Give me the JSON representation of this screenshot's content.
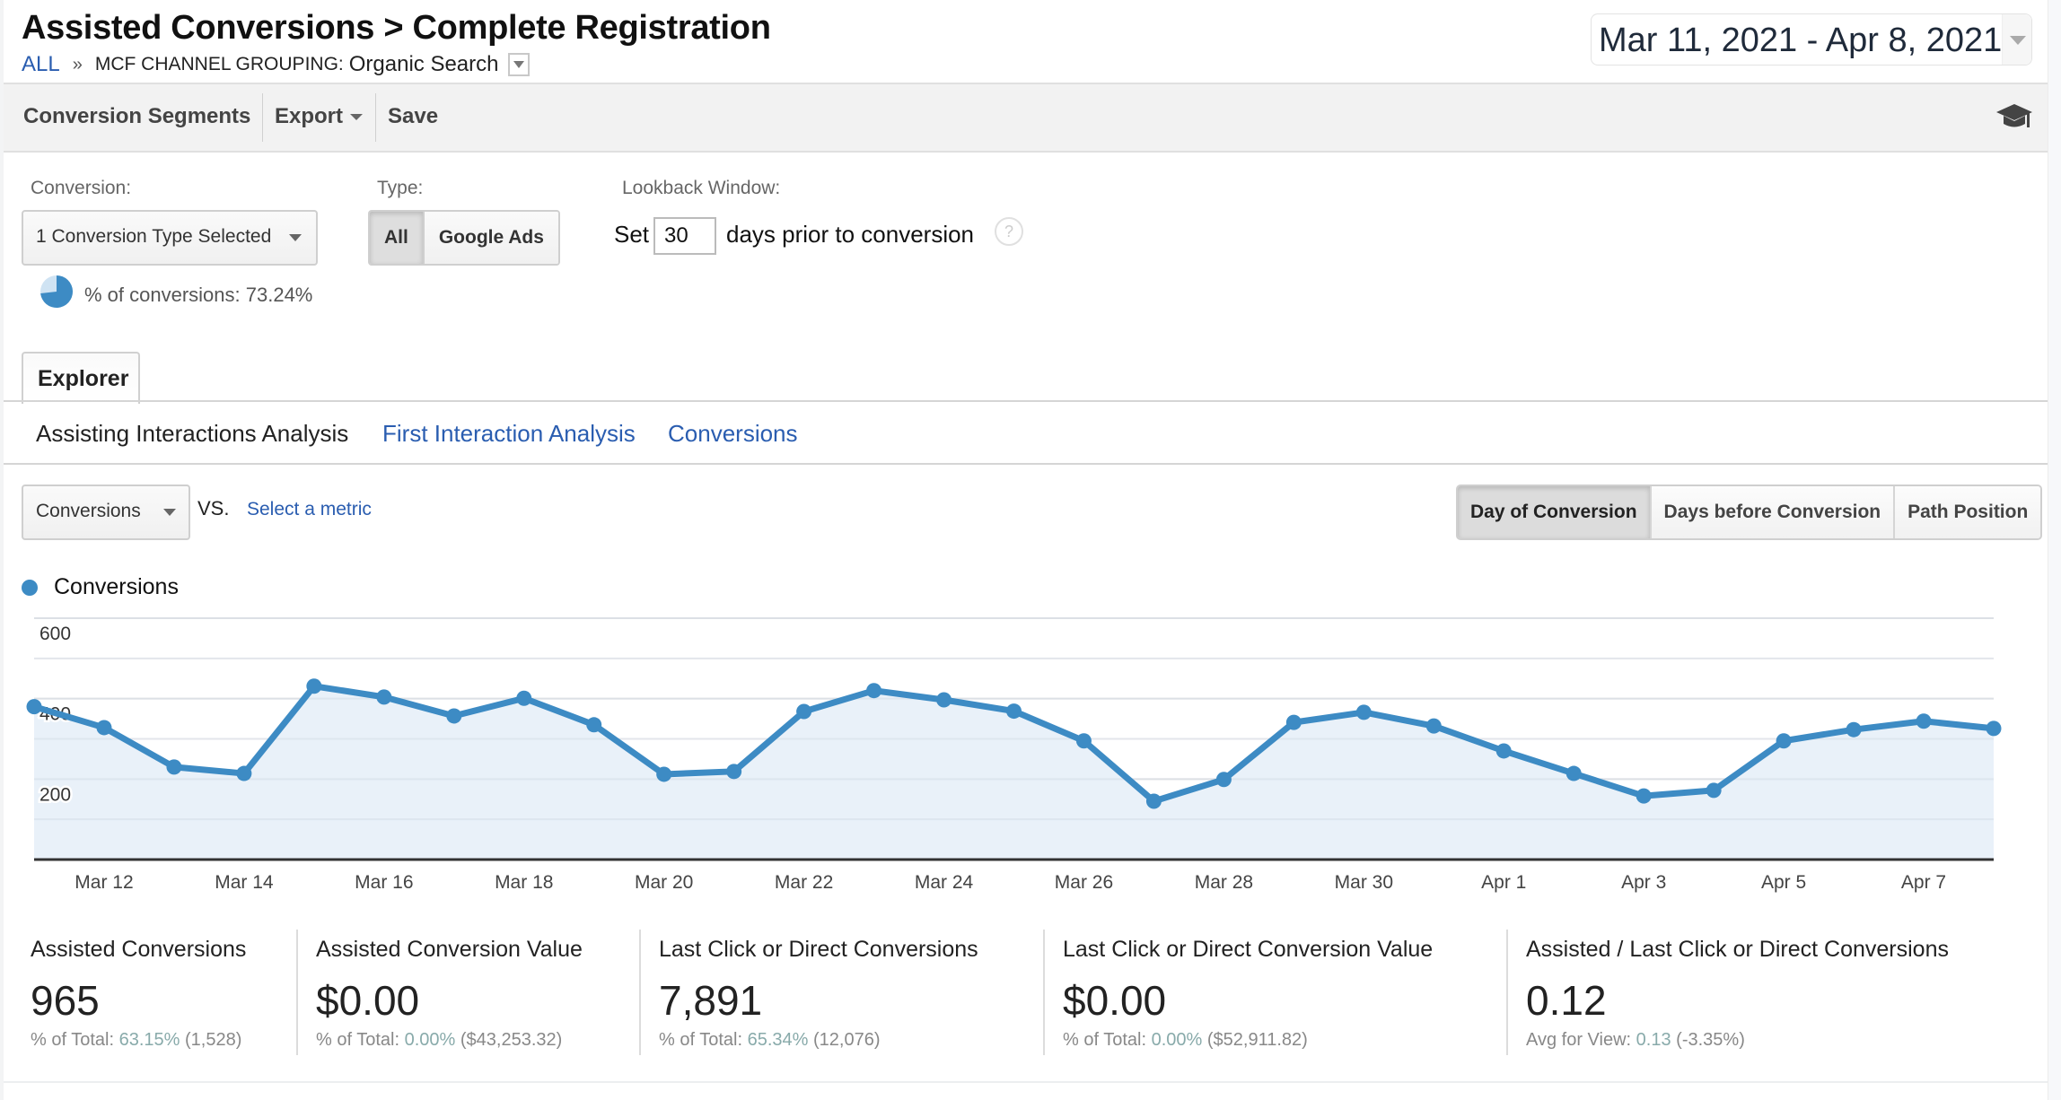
{
  "header": {
    "title": "Assisted Conversions > Complete Registration",
    "breadcrumb": {
      "all": "ALL",
      "separator": "»",
      "group_label": "MCF Channel Grouping:",
      "group_value": "Organic Search"
    },
    "date_range": "Mar 11, 2021 - Apr 8, 2021"
  },
  "toolbar": {
    "conversion_segments": "Conversion Segments",
    "export": "Export",
    "save": "Save",
    "help_icon": "graduation-cap-icon"
  },
  "controls": {
    "conversion_label": "Conversion:",
    "conversion_value": "1 Conversion Type Selected",
    "pct_of_conversions": "% of conversions: 73.24%",
    "pct_of_conversions_value": 73.24,
    "type_label": "Type:",
    "type_options": [
      "All",
      "Google Ads"
    ],
    "type_selected": "All",
    "lookback_label": "Lookback Window:",
    "lookback_prefix": "Set",
    "lookback_days": "30",
    "lookback_suffix": "days prior to conversion",
    "help": "?"
  },
  "tabs": {
    "explorer": "Explorer",
    "subtabs": [
      {
        "label": "Assisting Interactions Analysis",
        "active": true
      },
      {
        "label": "First Interaction Analysis",
        "active": false
      },
      {
        "label": "Conversions",
        "active": false
      }
    ]
  },
  "metric_row": {
    "metric": "Conversions",
    "vs": "VS.",
    "select_metric": "Select a metric",
    "views": [
      {
        "label": "Day of Conversion",
        "active": true
      },
      {
        "label": "Days before Conversion",
        "active": false
      },
      {
        "label": "Path Position",
        "active": false
      }
    ]
  },
  "colors": {
    "series": "#3d8bc4",
    "area": "#e9f1f9",
    "link": "#2a5db0"
  },
  "chart_data": {
    "type": "area",
    "title": "",
    "legend": [
      "Conversions"
    ],
    "legend_position": "top-left",
    "xlabel": "",
    "ylabel": "",
    "ylim": [
      0,
      600
    ],
    "y_ticks": [
      200,
      400,
      600
    ],
    "grid": true,
    "x_tick_labels": [
      "Mar 12",
      "Mar 14",
      "Mar 16",
      "Mar 18",
      "Mar 20",
      "Mar 22",
      "Mar 24",
      "Mar 26",
      "Mar 28",
      "Mar 30",
      "Apr 1",
      "Apr 3",
      "Apr 5",
      "Apr 7"
    ],
    "x": [
      "Mar 11",
      "Mar 12",
      "Mar 13",
      "Mar 14",
      "Mar 15",
      "Mar 16",
      "Mar 17",
      "Mar 18",
      "Mar 19",
      "Mar 20",
      "Mar 21",
      "Mar 22",
      "Mar 23",
      "Mar 24",
      "Mar 25",
      "Mar 26",
      "Mar 27",
      "Mar 28",
      "Mar 29",
      "Mar 30",
      "Mar 31",
      "Apr 1",
      "Apr 2",
      "Apr 3",
      "Apr 4",
      "Apr 5",
      "Apr 6",
      "Apr 7",
      "Apr 8"
    ],
    "series": [
      {
        "name": "Conversions",
        "values": [
          380,
          328,
          230,
          214,
          431,
          404,
          357,
          401,
          335,
          212,
          219,
          368,
          420,
          397,
          369,
          295,
          145,
          199,
          341,
          366,
          332,
          270,
          214,
          158,
          172,
          295,
          323,
          344,
          326
        ]
      }
    ]
  },
  "scorecards": [
    {
      "title": "Assisted Conversions",
      "value": "965",
      "sub_prefix": "% of Total:",
      "sub_pct": "63.15%",
      "sub_total": "(1,528)"
    },
    {
      "title": "Assisted Conversion Value",
      "value": "$0.00",
      "sub_prefix": "% of Total:",
      "sub_pct": "0.00%",
      "sub_total": "($43,253.32)"
    },
    {
      "title": "Last Click or Direct Conversions",
      "value": "7,891",
      "sub_prefix": "% of Total:",
      "sub_pct": "65.34%",
      "sub_total": "(12,076)"
    },
    {
      "title": "Last Click or Direct Conversion Value",
      "value": "$0.00",
      "sub_prefix": "% of Total:",
      "sub_pct": "0.00%",
      "sub_total": "($52,911.82)"
    },
    {
      "title": "Assisted / Last Click or Direct Conversions",
      "value": "0.12",
      "sub_prefix": "Avg for View:",
      "sub_pct": "0.13",
      "sub_total": "(-3.35%)"
    }
  ]
}
